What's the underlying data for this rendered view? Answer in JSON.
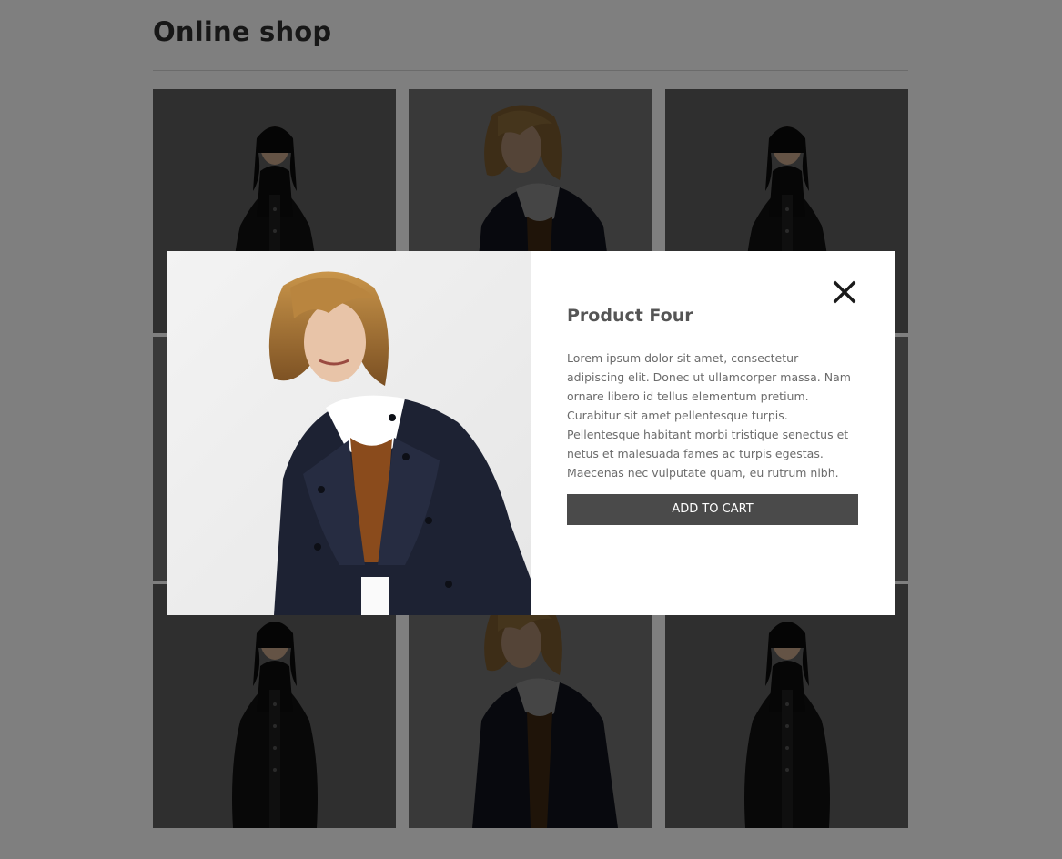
{
  "header": {
    "title": "Online shop"
  },
  "products": [
    {
      "model": "black-leather-jacket"
    },
    {
      "model": "navy-peacoat"
    },
    {
      "model": "black-leather-jacket"
    },
    {
      "model": "navy-peacoat"
    },
    {
      "model": "black-leather-jacket"
    },
    {
      "model": "navy-peacoat"
    },
    {
      "model": "black-leather-jacket"
    },
    {
      "model": "navy-peacoat"
    },
    {
      "model": "black-leather-jacket"
    }
  ],
  "modal": {
    "title": "Product Four",
    "description": "Lorem ipsum dolor sit amet, consectetur adipiscing elit. Donec ut ullamcorper massa. Nam ornare libero id tellus elementum pretium. Curabitur sit amet pellentesque turpis. Pellentesque habitant morbi tristique senectus et netus et malesuada fames ac turpis egestas. Maecenas nec vulputate quam, eu rutrum nibh.",
    "add_to_cart_label": "ADD TO CART",
    "close_icon": "close-icon"
  },
  "colors": {
    "overlay": "rgba(0,0,0,0.5)",
    "button_background": "#4a4a4a",
    "button_text": "#ffffff",
    "title_text": "#555555",
    "body_text": "#6b6b6b"
  }
}
